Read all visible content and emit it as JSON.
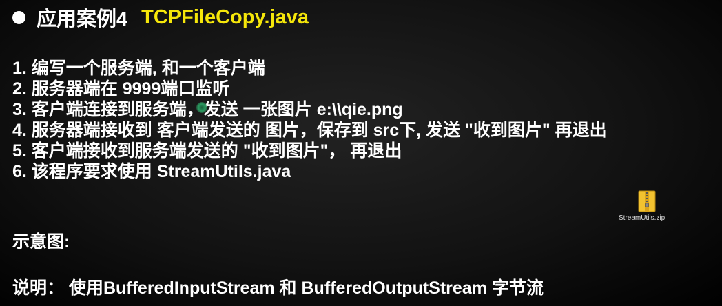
{
  "accent_color": "#f5e60a",
  "title": {
    "prefix": "应用案例4",
    "filename": "TCPFileCopy.java"
  },
  "items": [
    "1. 编写一个服务端, 和一个客户端",
    "2. 服务器端在 9999端口监听",
    "3. 客户端连接到服务端，发送 一张图片 e:\\\\qie.png",
    "4. 服务器端接收到 客户端发送的 图片，保存到 src下, 发送 \"收到图片\" 再退出",
    "5. 客户端接收到服务端发送的 \"收到图片\"， 再退出",
    "6. 该程序要求使用 StreamUtils.java"
  ],
  "attachment": {
    "icon": "zip-file-icon",
    "name": "StreamUtils.zip"
  },
  "diagram_label": "示意图:",
  "note": "说明：  使用BufferedInputStream 和 BufferedOutputStream 字节流"
}
